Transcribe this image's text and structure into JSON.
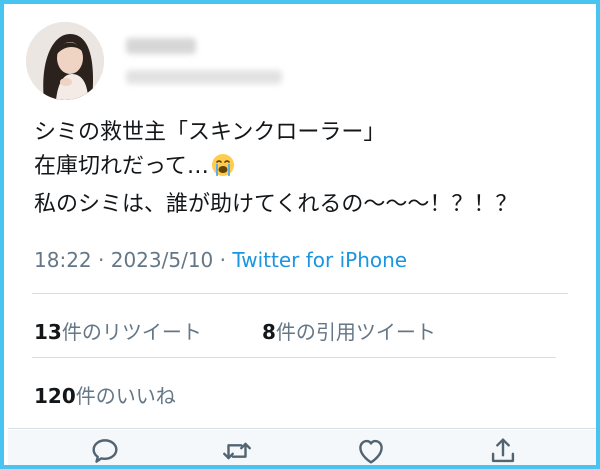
{
  "tweet": {
    "lines": [
      "シミの救世主「スキンクローラー」",
      "在庫切れだって…",
      "私のシミは、誰が助けてくれるの〜〜〜！？！？"
    ],
    "emoji": "crying-face-emoji"
  },
  "meta": {
    "time": "18:22",
    "sep1": " · ",
    "date": "2023/5/10",
    "sep2": " · ",
    "source": "Twitter for iPhone"
  },
  "stats": {
    "retweets": {
      "count": "13",
      "label": "件のリツイート"
    },
    "quotes": {
      "count": "8",
      "label": "件の引用ツイート"
    },
    "likes": {
      "count": "120",
      "label": "件のいいね"
    }
  },
  "actions": {
    "reply": "reply-icon",
    "retweet": "retweet-icon",
    "like": "heart-icon",
    "share": "share-icon"
  },
  "colors": {
    "frame": "#49c4f0",
    "text": "#14171a",
    "secondary": "#657786",
    "link": "#1b95e0",
    "icon": "#536471",
    "divider": "#d8dee2"
  }
}
